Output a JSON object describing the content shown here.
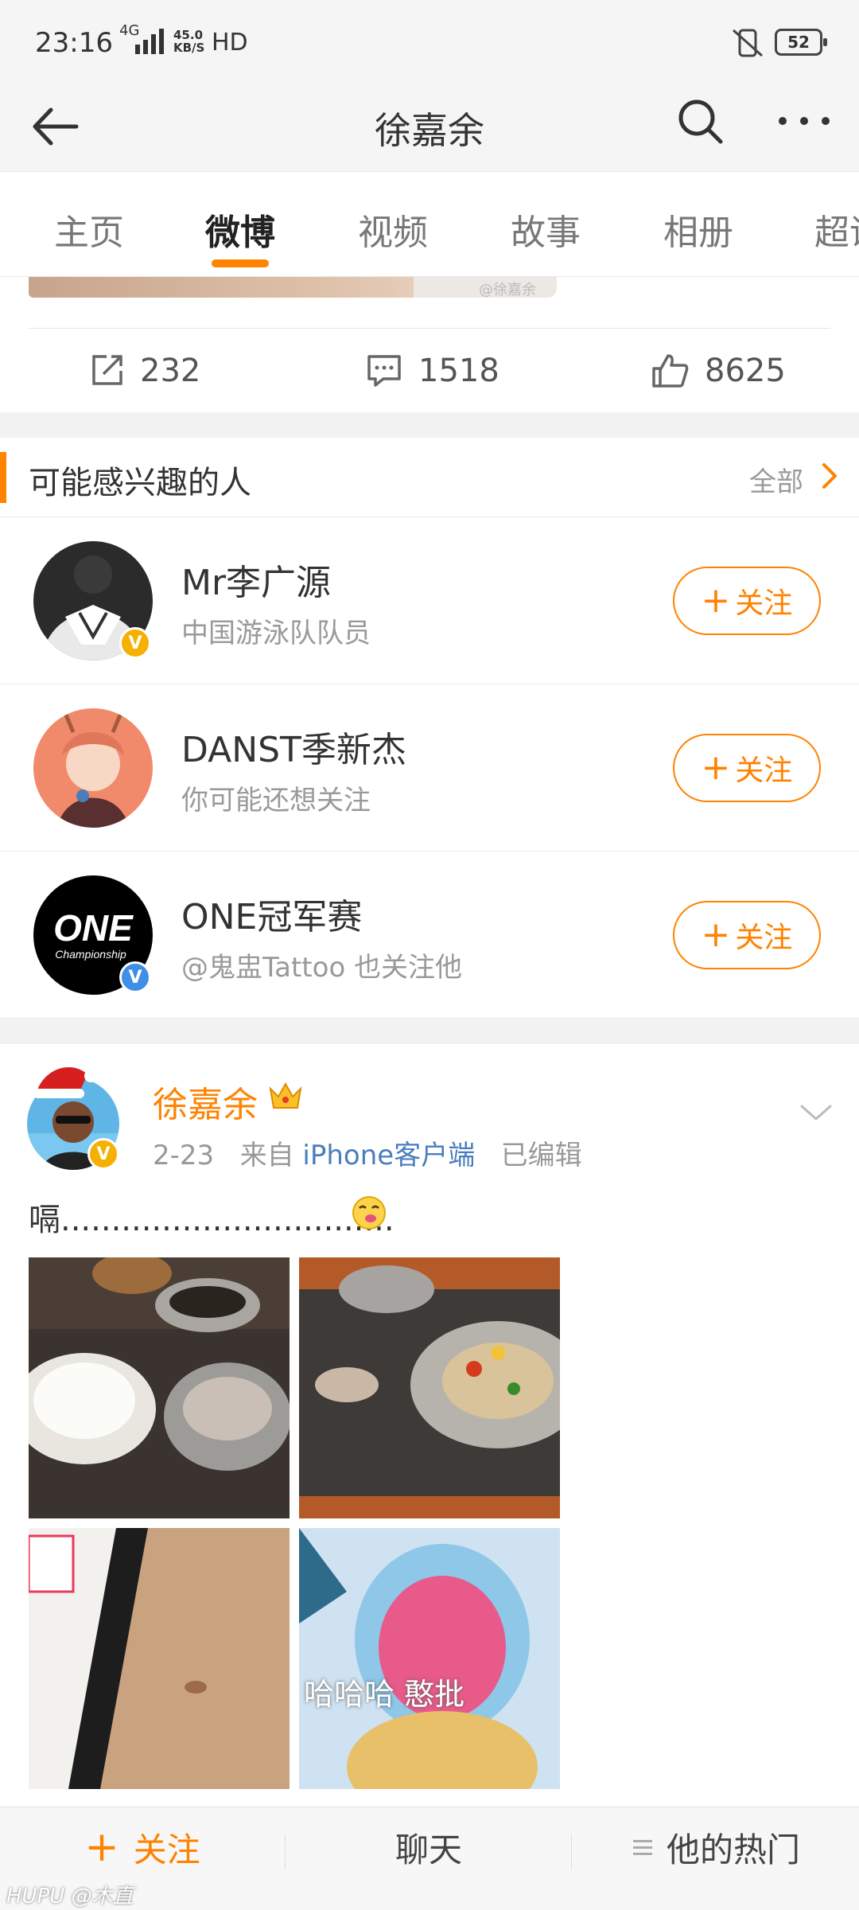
{
  "status_bar": {
    "time": "23:16",
    "network": "4G",
    "speed_value": "45.0",
    "speed_unit": "KB/S",
    "hd": "HD",
    "battery": "52"
  },
  "nav": {
    "title": "徐嘉余"
  },
  "tabs": [
    {
      "label": "主页"
    },
    {
      "label": "微博"
    },
    {
      "label": "视频"
    },
    {
      "label": "故事"
    },
    {
      "label": "相册"
    },
    {
      "label": "超话"
    }
  ],
  "active_tab": "微博",
  "prev_post": {
    "watermark": "@徐嘉余",
    "reposts": "232",
    "comments": "1518",
    "likes": "8625"
  },
  "suggestions": {
    "title": "可能感兴趣的人",
    "all_label": "全部",
    "follow_label": "关注",
    "people": [
      {
        "name": "Mr李广源",
        "desc": "中国游泳队队员",
        "badge_color": "#f6b100"
      },
      {
        "name": "DANST季新杰",
        "desc": "你可能还想关注",
        "badge_color": ""
      },
      {
        "name": "ONE冠军赛",
        "desc": "@鬼盅Tattoo 也关注他",
        "badge_color": "#3f8ee8"
      }
    ]
  },
  "post": {
    "author": "徐嘉余",
    "date": "2-23",
    "from_label": "来自",
    "source": "iPhone客户端",
    "edited": "已编辑",
    "text": "嗝.................................",
    "photo4_caption": "哈哈哈 憨批"
  },
  "bottom_bar": {
    "follow": "关注",
    "chat": "聊天",
    "hot": "他的热门"
  },
  "watermark": "HUPU @木直",
  "colors": {
    "accent": "#ff8200",
    "link": "#4a7ebb",
    "verified_gold": "#f6b100",
    "verified_blue": "#3f8ee8"
  }
}
